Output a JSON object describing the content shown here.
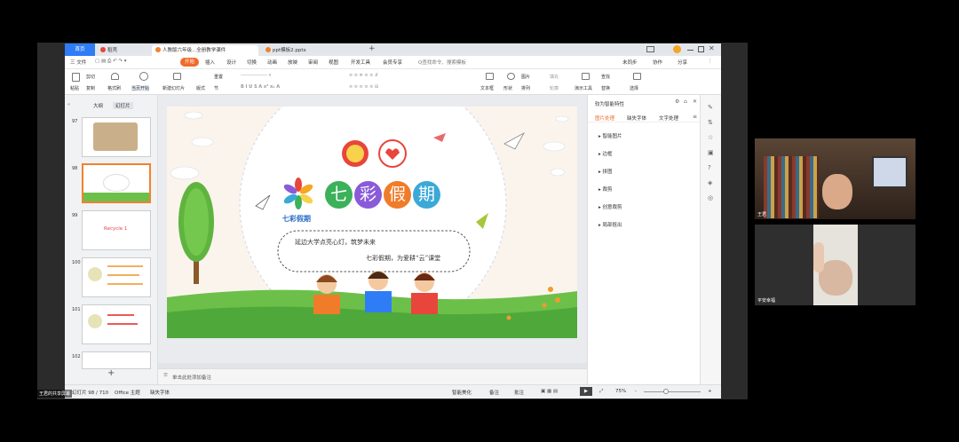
{
  "tabs": {
    "home": "首页",
    "wps": "稻壳",
    "doc1": "人教版六年级...全册教学课件",
    "doc2": "ppt模板2.pptx",
    "add": "+"
  },
  "menu": {
    "file": "三 文件",
    "start": "开始",
    "insert": "插入",
    "design": "设计",
    "switch": "切换",
    "animation": "动画",
    "show": "放映",
    "review": "审阅",
    "view": "视图",
    "dev": "开发工具",
    "member": "会员专享",
    "search": "Q查找命令、搜索模板",
    "unsynced": "未同步",
    "collab": "协作",
    "share": "分享"
  },
  "ribbon": {
    "paste": "粘贴",
    "cut": "剪切",
    "copy": "复制",
    "format_painter": "格式刷",
    "from_current": "当页开始",
    "new_slide": "新建幻灯片",
    "layout": "版式",
    "section": "节",
    "reset": "重置",
    "textbox": "文本框",
    "shape": "形状",
    "arrange": "排列",
    "picture": "图片",
    "fill": "填充",
    "outline": "轮廓",
    "present_tool": "演示工具",
    "find": "查找",
    "replace": "替换",
    "select": "选择"
  },
  "left_panel": {
    "outline_tab": "大纲",
    "slides_tab": "幻灯片",
    "thumbs": [
      {
        "num": "97"
      },
      {
        "num": "98"
      },
      {
        "num": "99",
        "text": "Recycle 1"
      },
      {
        "num": "100"
      },
      {
        "num": "101"
      },
      {
        "num": "102"
      }
    ],
    "add": "+"
  },
  "slide": {
    "title_chars": [
      "七",
      "彩",
      "假",
      "期"
    ],
    "logo_text": "七彩假期",
    "line1": "延边大学点亮心灯，筑梦未来",
    "line2": "七彩假期，为爱耕“云”课堂",
    "colors": {
      "title1": "#3bb15a",
      "title2": "#8a5bd8",
      "title3": "#f07c2a",
      "title4": "#3ba9d8"
    }
  },
  "notes": {
    "placeholder": "单击此处添加备注"
  },
  "right_panel": {
    "header": "较为智能特性",
    "tabs": [
      "图片处理",
      "缺失字体",
      "文字处理"
    ],
    "items": [
      "智能图片",
      "边框",
      "拼图",
      "裁剪",
      "创意裁剪",
      "局部抠出"
    ]
  },
  "status": {
    "slide_info": "幻灯片 98 / 710",
    "theme": "Office 主题",
    "missing_font": "缺失字体",
    "beautify": "智能美化",
    "notes": "备注",
    "comment": "批注",
    "zoom": "75%",
    "plus": "+",
    "minus": "-"
  },
  "videos": {
    "v1_label": "王君",
    "v2_label": "平安幸福"
  },
  "speaker": "王君的共享屏幕"
}
